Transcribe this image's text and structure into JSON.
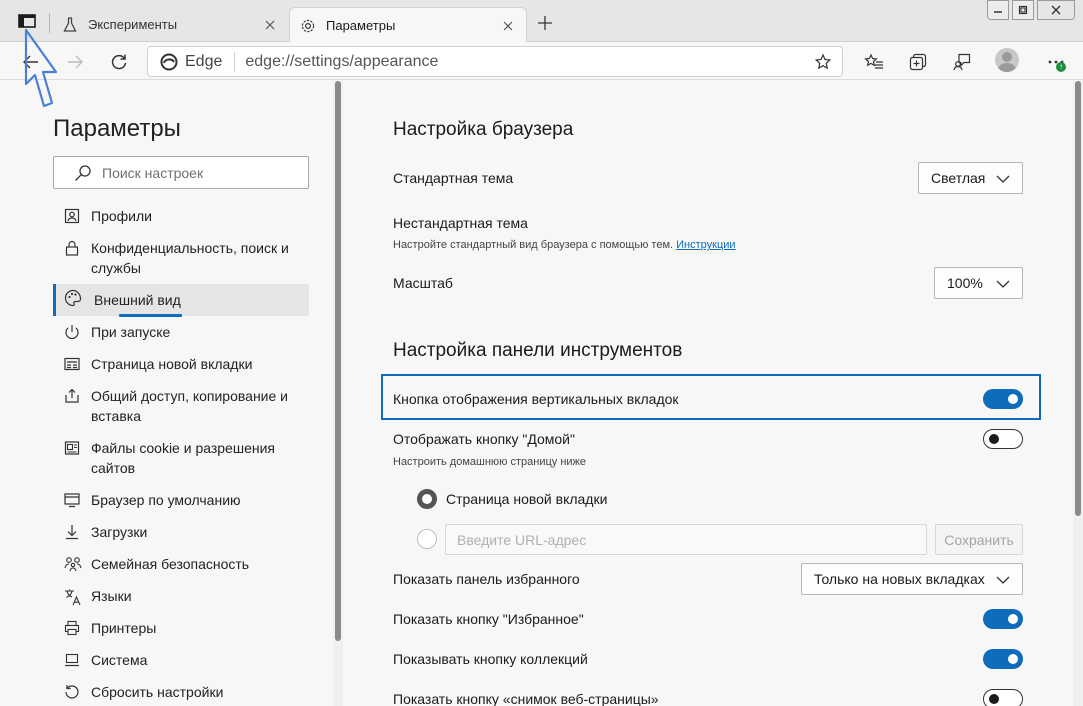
{
  "tabs": [
    {
      "label": "Эксперименты"
    },
    {
      "label": "Параметры"
    }
  ],
  "address": {
    "edge_label": "Edge",
    "url": "edge://settings/appearance"
  },
  "sidebar": {
    "title": "Параметры",
    "search_placeholder": "Поиск настроек",
    "items": [
      {
        "label": "Профили",
        "icon": "profile-icon"
      },
      {
        "label": "Конфиденциальность, поиск и службы",
        "icon": "lock-icon"
      },
      {
        "label": "Внешний вид",
        "icon": "palette-icon",
        "active": true
      },
      {
        "label": "При запуске",
        "icon": "power-icon"
      },
      {
        "label": "Страница новой вкладки",
        "icon": "newtab-page-icon"
      },
      {
        "label": "Общий доступ, копирование и вставка",
        "icon": "share-icon"
      },
      {
        "label": "Файлы cookie и разрешения сайтов",
        "icon": "cookie-icon"
      },
      {
        "label": "Браузер по умолчанию",
        "icon": "default-browser-icon"
      },
      {
        "label": "Загрузки",
        "icon": "download-icon"
      },
      {
        "label": "Семейная безопасность",
        "icon": "family-icon"
      },
      {
        "label": "Языки",
        "icon": "languages-icon"
      },
      {
        "label": "Принтеры",
        "icon": "printer-icon"
      },
      {
        "label": "Система",
        "icon": "system-icon"
      },
      {
        "label": "Сбросить настройки",
        "icon": "reset-icon"
      }
    ]
  },
  "main": {
    "browser_section": {
      "title": "Настройка браузера",
      "default_theme_label": "Стандартная тема",
      "default_theme_value": "Светлая",
      "custom_theme_label": "Нестандартная тема",
      "custom_theme_desc": "Настройте стандартный вид браузера с помощью тем.",
      "custom_theme_link": "Инструкции",
      "zoom_label": "Масштаб",
      "zoom_value": "100%"
    },
    "toolbar_section": {
      "title": "Настройка панели инструментов",
      "vertical_tabs_label": "Кнопка отображения вертикальных вкладок",
      "vertical_tabs_on": true,
      "home_label": "Отображать кнопку \"Домой\"",
      "home_on": false,
      "home_desc": "Настроить домашнюю страницу ниже",
      "radio_newtab_label": "Страница новой вкладки",
      "url_placeholder": "Введите URL-адрес",
      "save_label": "Сохранить",
      "favbar_label": "Показать панель избранного",
      "favbar_value": "Только на новых вкладках",
      "fav_button_label": "Показать кнопку \"Избранное\"",
      "fav_button_on": true,
      "collections_label": "Показывать кнопку коллекций",
      "collections_on": true,
      "capture_label": "Показать кнопку «снимок веб-страницы»",
      "capture_on": false
    }
  },
  "colors": {
    "accent": "#0f6cbd",
    "annotation": "#4a7fd4"
  }
}
